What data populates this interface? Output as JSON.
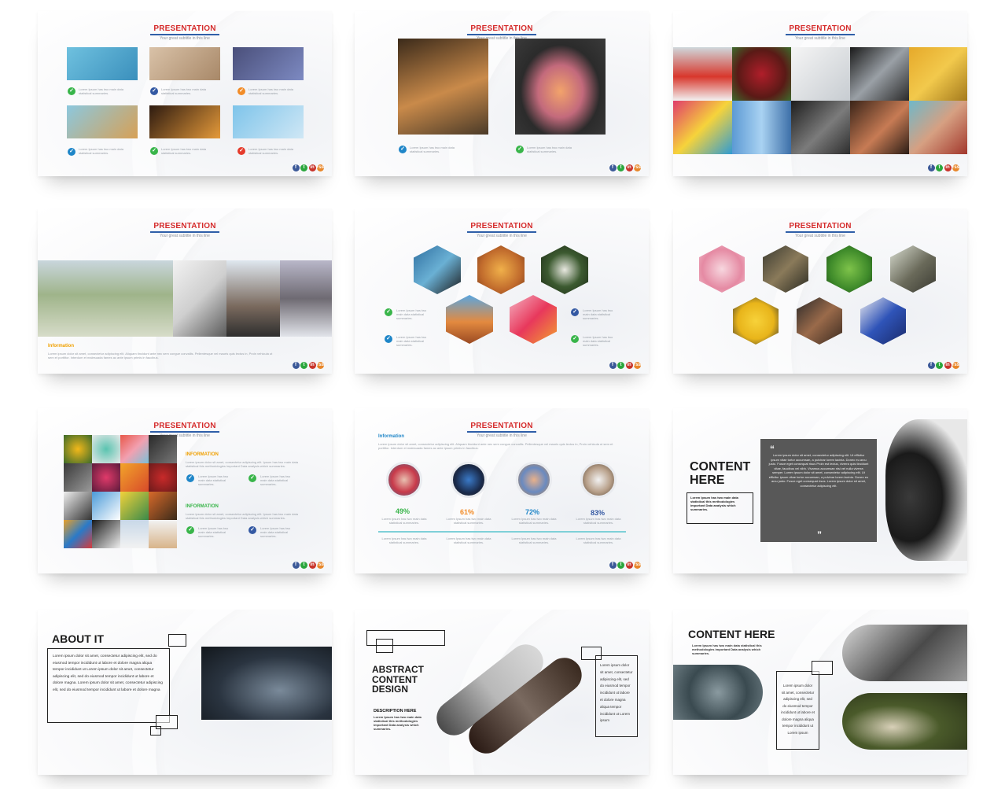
{
  "common": {
    "title": "PRESENTATION",
    "subtitle": "Your great subtitle in this line",
    "lorem_short": "Lorem Ipsum has two main data statistical summaries.",
    "lorem_long": "Lorem ipsum dolor sit amet, consectetur adipiscing elit. Aliquam tincidunt ante nec sem congue convallis. Pellentesque vel mauris quis lectus in, Proin vehicula ut sem et porttitor. Interdum et malesuada fames ac ante ipsum primis in faucibus.",
    "social": {
      "fb": "f",
      "tw": "t",
      "in": "in",
      "rs": "rss"
    }
  },
  "slide4": {
    "info_label": "Information"
  },
  "slide7": {
    "info1": "INFORMATION",
    "info1_text": "Lorem ipsum dolor sit amet, consectetur adipiscing elit. Ipsum has two main data statistical this methodologies important Data analysis which summaries.",
    "info2": "INFORMATION",
    "info2_text": "Lorem ipsum dolor sit amet, consectetur adipiscing elit. Ipsum has two main data statistical this methodologies important Data analysis which summaries."
  },
  "slide8": {
    "info_label": "Information",
    "percents": [
      "49%",
      "61%",
      "72%",
      "83%"
    ],
    "percent_colors": [
      "#39b54a",
      "#f28c28",
      "#1f86c8",
      "#3459a3"
    ]
  },
  "slide9": {
    "heading_line1": "CONTENT",
    "heading_line2": "HERE",
    "box_text": "Lorem Ipsum has two main data statistical this methodologies important Data analysis which summaries.",
    "quote_text": "Lorem ipsum dolor sit amet, consectetur adipiscing elit. Ut efficitur ipsum vitae tortor accumsan, a pulvinar lorem lacinia. Donec eu arcu justo. Fusce eget consequat risus Proin est lectus, viverra quis tincidunt vitae, faucibus vel nibh. Vivamus accumsan nisi vel nulla viverra semper. Lorem ipsum dolor sit amet, consectetur adipiscing elit. Ut efficitur ipsum vitae tortor accumsan, a pulvinar lorem lacinia. Donec eu arcu justo. Fusce eget consequat risus. Lorem ipsum dolor sit amet, consectetur adipiscing elit."
  },
  "slide10": {
    "heading": "ABOUT IT",
    "body": "Lorem ipsum dolor sit amet, consectetur adipiscing elit, sed do eiusmod tempor incididunt ut labore et dolore magna aliqua tempor incididunt ut Lorem ipsum dolor sit amet, consectetur adipiscing elit, sed do eiusmod tempor incididunt ut labore et dolore magna. Lorem ipsum dolor sit amet, consectetur adipiscing elit, sed do eiusmod tempor incididunt ut labore et dolore magna"
  },
  "slide11": {
    "heading_line1": "ABSTRACT",
    "heading_line2": "CONTENT",
    "heading_line3": "DESIGN",
    "desc_label": "DESCRIPTION HERE",
    "desc_text": "Lorem Ipsum has two main data statistical this methodologies important Data analysis which summaries.",
    "side_text": "Lorem ipsum dolor sit amet, consectetur adipiscing elit, sed do eiusmod tempor incididunt ut labore et dolore magna aliqua tempor incididunt ut Lorem ipsum"
  },
  "slide12": {
    "heading": "CONTENT HERE",
    "sub_text": "Lorem Ipsum has two main data statistical this methodologies important Data analysis which summaries.",
    "box_text": "Lorem ipsum dolor sit amet, consectetur adipiscing elit, sed do eiusmod tempor incididunt ut labore et dolore magna aliqua tempor incididunt ut Lorem ipsum"
  }
}
